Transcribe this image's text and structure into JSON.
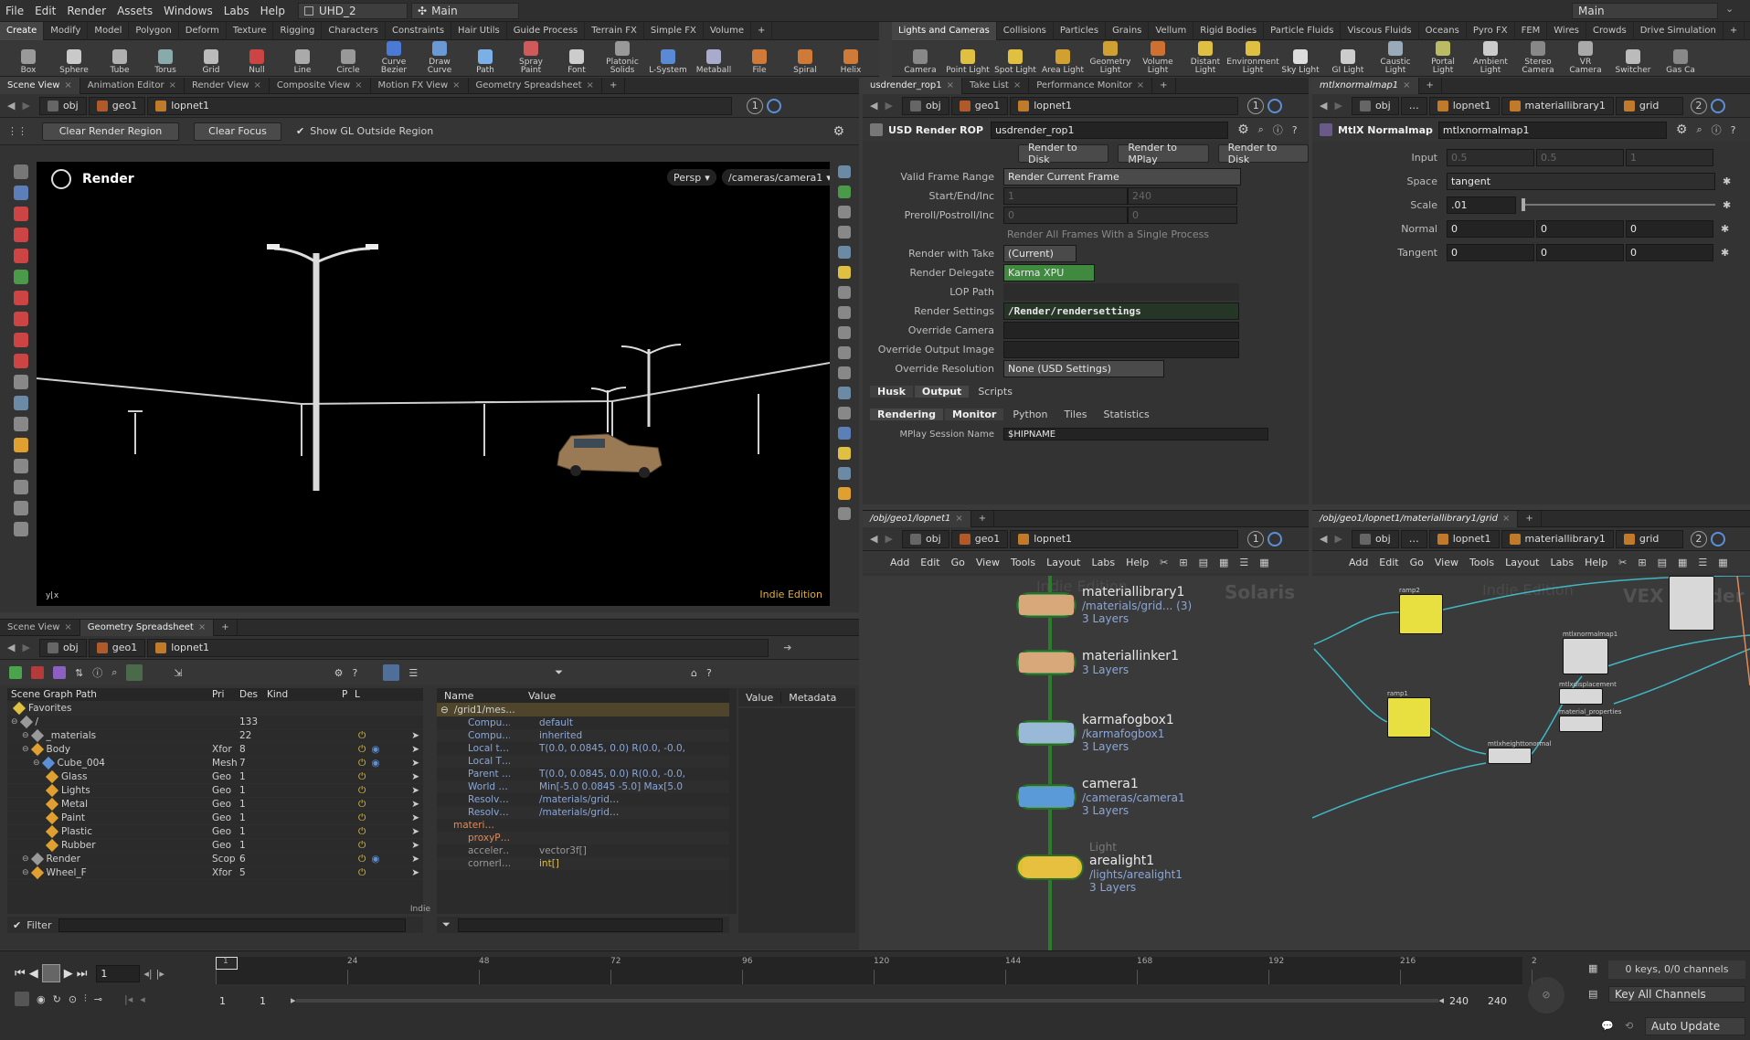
{
  "menubar": {
    "items": [
      "File",
      "Edit",
      "Render",
      "Assets",
      "Windows",
      "Labs",
      "Help"
    ],
    "desktop": "UHD_2",
    "context": "Main",
    "right_context": "Main"
  },
  "shelf_left": {
    "tabs": [
      "Create",
      "Modify",
      "Model",
      "Polygon",
      "Deform",
      "Texture",
      "Rigging",
      "Characters",
      "Constraints",
      "Hair Utils",
      "Guide Process",
      "Terrain FX",
      "Simple FX",
      "Volume"
    ],
    "tools": [
      "Box",
      "Sphere",
      "Tube",
      "Torus",
      "Grid",
      "Null",
      "Line",
      "Circle",
      "Curve Bezier",
      "Draw Curve",
      "Path",
      "Spray Paint",
      "Font",
      "Platonic Solids",
      "L-System",
      "Metaball",
      "File",
      "Spiral",
      "Helix"
    ]
  },
  "shelf_right": {
    "tabs": [
      "Lights and Cameras",
      "Collisions",
      "Particles",
      "Grains",
      "Vellum",
      "Rigid Bodies",
      "Particle Fluids",
      "Viscous Fluids",
      "Oceans",
      "Pyro FX",
      "FEM",
      "Wires",
      "Crowds",
      "Drive Simulation"
    ],
    "tools": [
      "Camera",
      "Point Light",
      "Spot Light",
      "Area Light",
      "Geometry Light",
      "Volume Light",
      "Distant Light",
      "Environment Light",
      "Sky Light",
      "GI Light",
      "Caustic Light",
      "Portal Light",
      "Ambient Light",
      "Stereo Camera",
      "VR Camera",
      "Switcher",
      "Gas Ca"
    ]
  },
  "viewer": {
    "tabs": [
      "Scene View",
      "Animation Editor",
      "Render View",
      "Composite View",
      "Motion FX View",
      "Geometry Spreadsheet"
    ],
    "path": [
      "obj",
      "geo1",
      "lopnet1"
    ],
    "clear_region": "Clear Render Region",
    "clear_focus": "Clear Focus",
    "show_gl": "Show GL Outside Region",
    "title": "Render",
    "persp": "Persp",
    "camera": "/cameras/camera1",
    "watermark": "Indie Edition",
    "viewport_num": "1"
  },
  "bottom_left": {
    "tabs": [
      "Scene View",
      "Geometry Spreadsheet"
    ],
    "path": [
      "obj",
      "geo1",
      "lopnet1"
    ],
    "tree_headers": [
      "Scene Graph Path",
      "Pri",
      "Des",
      "Kind",
      "P",
      "L"
    ],
    "tree_rows": [
      {
        "name": "Favorites",
        "pri": "",
        "des": "",
        "kind": ""
      },
      {
        "name": "/",
        "pri": "",
        "des": "133",
        "kind": ""
      },
      {
        "name": "_materials",
        "pri": "",
        "des": "22",
        "kind": ""
      },
      {
        "name": "Body",
        "pri": "Xfor",
        "des": "8",
        "kind": ""
      },
      {
        "name": "Cube_004",
        "pri": "Mesh",
        "des": "7",
        "kind": ""
      },
      {
        "name": "Glass",
        "pri": "Geo",
        "des": "1",
        "kind": ""
      },
      {
        "name": "Lights",
        "pri": "Geo",
        "des": "1",
        "kind": ""
      },
      {
        "name": "Metal",
        "pri": "Geo",
        "des": "1",
        "kind": ""
      },
      {
        "name": "Paint",
        "pri": "Geo",
        "des": "1",
        "kind": ""
      },
      {
        "name": "Plastic",
        "pri": "Geo",
        "des": "1",
        "kind": ""
      },
      {
        "name": "Rubber",
        "pri": "Geo",
        "des": "1",
        "kind": ""
      },
      {
        "name": "Render",
        "pri": "Scop",
        "des": "6",
        "kind": ""
      },
      {
        "name": "Wheel_F",
        "pri": "Xfor",
        "des": "5",
        "kind": ""
      }
    ],
    "filter_label": "Filter",
    "attr_headers": [
      "Name",
      "Value"
    ],
    "attr_root": "/grid1/mes…",
    "attr_rows": [
      {
        "name": "Compu…",
        "value": "default"
      },
      {
        "name": "Compu…",
        "value": "inherited"
      },
      {
        "name": "Local t…",
        "value": "T(0.0, 0.0845, 0.0) R(0.0, -0.0, 0.0) …"
      },
      {
        "name": "Local T…",
        "value": ""
      },
      {
        "name": "Parent …",
        "value": "T(0.0, 0.0845, 0.0) R(0.0, -0.0, 0.0) …"
      },
      {
        "name": "World …",
        "value": "Min[-5.0 0.0845 -5.0] Max[5.0 0.08…"
      },
      {
        "name": "Resolv…",
        "value": "/materials/grid…"
      },
      {
        "name": "Resolv…",
        "value": "/materials/grid…"
      },
      {
        "name": "materi…",
        "value": ""
      },
      {
        "name": "proxyP…",
        "value": ""
      },
      {
        "name": "acceler…",
        "value": "vector3f[]"
      },
      {
        "name": "cornerI…",
        "value": "int[]"
      }
    ],
    "value_tab": "Value",
    "metadata_tab": "Metadata",
    "indie_tag": "Indie"
  },
  "rop": {
    "tabs": [
      "usdrender_rop1",
      "Take List",
      "Performance Monitor"
    ],
    "path": [
      "obj",
      "geo1",
      "lopnet1"
    ],
    "node_type": "USD Render ROP",
    "node_name": "usdrender_rop1",
    "buttons": [
      "Render to Disk",
      "Render to MPlay",
      "Render to Disk"
    ],
    "params": [
      {
        "label": "Valid Frame Range",
        "value": "Render Current Frame"
      },
      {
        "label": "Start/End/Inc",
        "value": "1"
      },
      {
        "label": "Preroll/Postroll/Inc",
        "value": "0"
      },
      {
        "label": "",
        "value": "Render All Frames With a Single Process"
      },
      {
        "label": "Render with Take",
        "value": "(Current)"
      },
      {
        "label": "Render Delegate",
        "value": "Karma XPU"
      },
      {
        "label": "LOP Path",
        "value": ""
      },
      {
        "label": "Render Settings",
        "value": "/Render/rendersettings"
      },
      {
        "label": "Override Camera",
        "value": ""
      },
      {
        "label": "Override Output Image",
        "value": ""
      },
      {
        "label": "Override Resolution",
        "value": "None (USD Settings)"
      }
    ],
    "end_value": "240",
    "preroll_value": "0",
    "subtabs1": [
      "Husk",
      "Output",
      "Scripts"
    ],
    "subtabs2": [
      "Rendering",
      "Monitor",
      "Python",
      "Tiles",
      "Statistics"
    ],
    "mplay_label": "MPlay Session Name",
    "mplay_value": "$HIPNAME"
  },
  "mtlx": {
    "tab": "mtlxnormalmap1",
    "path": [
      "obj",
      "…",
      "lopnet1",
      "materiallibrary1",
      "grid"
    ],
    "node_type": "MtlX Normalmap",
    "node_name": "mtlxnormalmap1",
    "params": [
      {
        "label": "Input",
        "v1": "0.5",
        "v2": "0.5",
        "v3": "1"
      },
      {
        "label": "Space",
        "v1": "tangent"
      },
      {
        "label": "Scale",
        "v1": ".01"
      },
      {
        "label": "Normal",
        "v1": "0",
        "v2": "0",
        "v3": "0"
      },
      {
        "label": "Tangent",
        "v1": "0",
        "v2": "0",
        "v3": "0"
      }
    ],
    "viewport_num": "2"
  },
  "network": {
    "tab": "/obj/geo1/lopnet1",
    "path": [
      "obj",
      "geo1",
      "lopnet1"
    ],
    "menu": [
      "Add",
      "Edit",
      "Go",
      "View",
      "Tools",
      "Layout",
      "Labs",
      "Help"
    ],
    "watermark": "Indie Edition",
    "context": "Solaris",
    "nodes": [
      {
        "name": "materiallibrary1",
        "sub": "/materials/grid... (3)",
        "layers": "3 Layers"
      },
      {
        "name": "materiallinker1",
        "sub": "",
        "layers": "3 Layers"
      },
      {
        "name": "karmafogbox1",
        "sub": "/karmafogbox1",
        "layers": "3 Layers"
      },
      {
        "name": "camera1",
        "sub": "/cameras/camera1",
        "layers": "3 Layers"
      },
      {
        "name": "arealight1",
        "sub": "/lights/arealight1",
        "layers": "3 Layers",
        "pre": "Light"
      }
    ]
  },
  "vex": {
    "tab": "/obj/geo1/lopnet1/materiallibrary1/grid",
    "path": [
      "obj",
      "…",
      "lopnet1",
      "materiallibrary1",
      "grid"
    ],
    "menu": [
      "Add",
      "Edit",
      "Go",
      "View",
      "Tools",
      "Layout",
      "Labs",
      "Help"
    ],
    "watermark": "Indie Edition",
    "context": "VEX Builder",
    "nodes": [
      "ramp2",
      "ramp1",
      "mtlxnormalmap1",
      "mtlxdisplacement",
      "material_properties",
      "mtlxheighttonormal"
    ]
  },
  "timeline": {
    "frame": "1",
    "ticks": [
      "1",
      "24",
      "48",
      "72",
      "96",
      "120",
      "144",
      "168",
      "192",
      "216",
      "2"
    ],
    "start": "1",
    "start2": "1",
    "end": "240",
    "end2": "240",
    "keys": "0 keys, 0/0 channels",
    "key_all": "Key All Channels",
    "auto_update": "Auto Update"
  }
}
